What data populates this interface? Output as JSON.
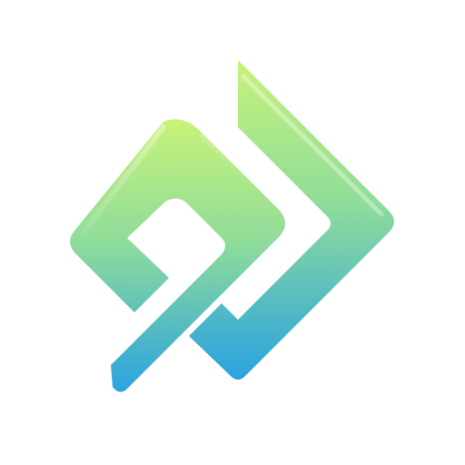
{
  "logo": {
    "name": "app-logo-mark",
    "colors": {
      "gradient_top": "#c8f27a",
      "gradient_mid": "#8fdc9a",
      "gradient_bottom": "#2aa3e0",
      "highlight": "#ffffff"
    }
  }
}
